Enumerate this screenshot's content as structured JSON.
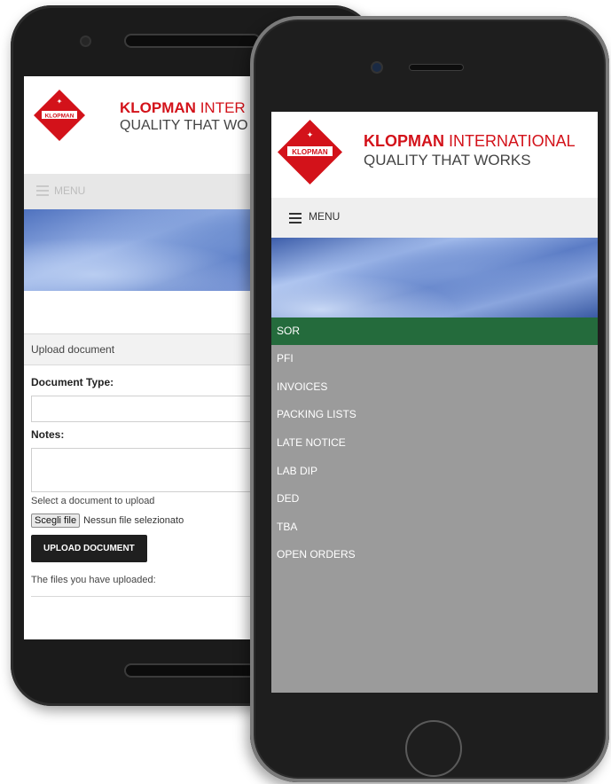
{
  "back_phone": {
    "brand_bold": "KLOPMAN",
    "brand_rest": "INTER",
    "tagline": "QUALITY THAT WO",
    "logo_text": "KLOPMAN",
    "menu_label": "MENU",
    "upload_heading": "Upload document",
    "document_type_label": "Document Type:",
    "notes_label": "Notes:",
    "select_prompt": "Select a document to upload",
    "choose_file_button": "Scegli file",
    "no_file_text": "Nessun file selezionato",
    "upload_button": "UPLOAD DOCUMENT",
    "uploaded_files_label": "The files you have uploaded:"
  },
  "front_phone": {
    "brand_bold": "KLOPMAN",
    "brand_rest": "INTERNATIONAL",
    "tagline": "QUALITY THAT WORKS",
    "logo_text": "KLOPMAN",
    "menu_label": "MENU",
    "nav_items": [
      {
        "label": "SOR"
      },
      {
        "label": "PFI"
      },
      {
        "label": "INVOICES"
      },
      {
        "label": "PACKING LISTS"
      },
      {
        "label": "LATE NOTICE"
      },
      {
        "label": "LAB DIP"
      },
      {
        "label": "DED"
      },
      {
        "label": "TBA"
      },
      {
        "label": "OPEN ORDERS"
      }
    ],
    "active_item": "SOR"
  },
  "colors": {
    "brand_red": "#d3121a",
    "active_nav": "#246b3c",
    "nav_background": "#9b9b9b"
  }
}
